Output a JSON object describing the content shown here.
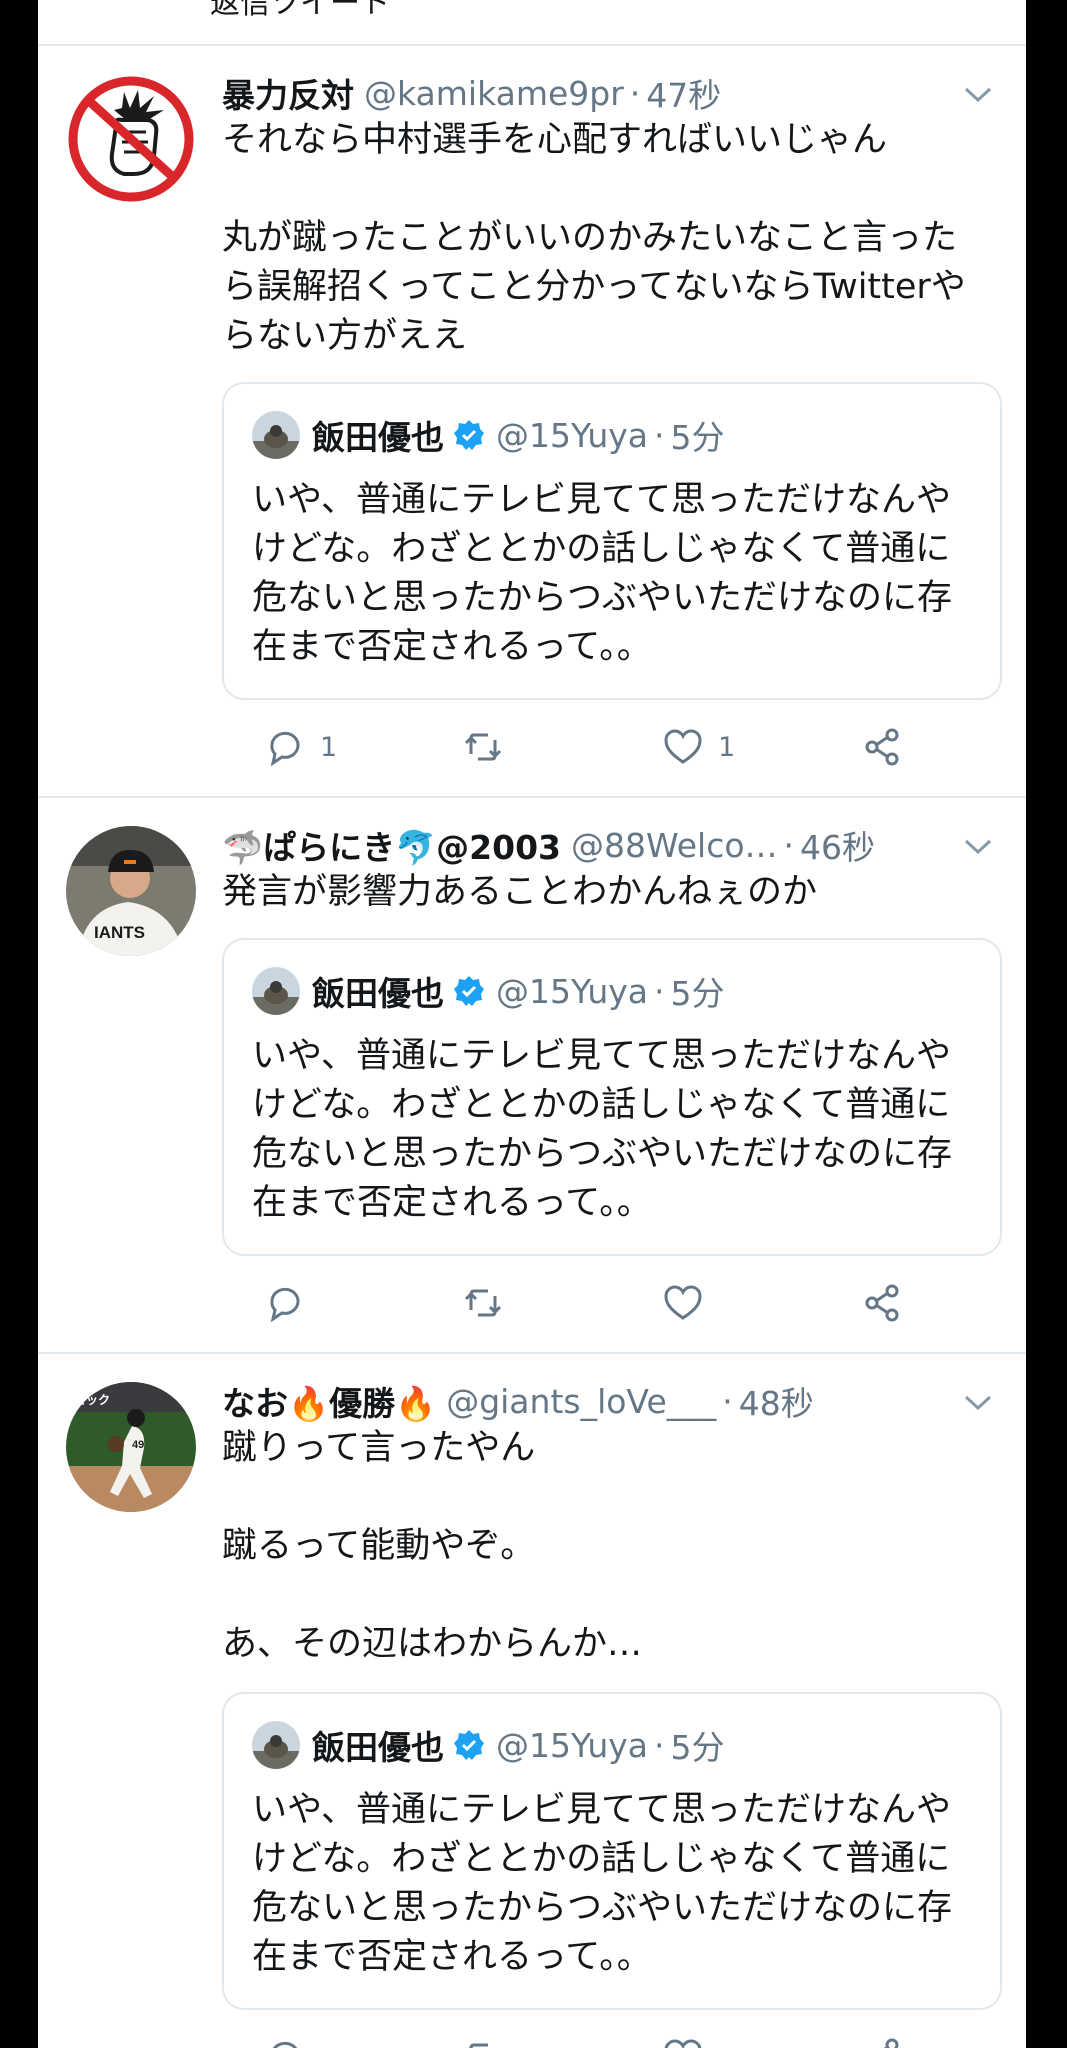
{
  "top_cut_text": "返信ツイート",
  "tweets": [
    {
      "name": "暴力反対",
      "handle": "@kamikame9pr",
      "time": "47秒",
      "text": "それなら中村選手を心配すればいいじゃん\n\n丸が蹴ったことがいいのかみたいなこと言ったら誤解招くってこと分かってないならTwitterやらない方がええ",
      "reply_count": "1",
      "retweet_count": "",
      "like_count": "1"
    },
    {
      "name": "🦈ぱらにき🐬@2003",
      "handle": "@88Welco…",
      "time": "46秒",
      "text": "発言が影響力あることわかんねぇのか",
      "reply_count": "",
      "retweet_count": "",
      "like_count": ""
    },
    {
      "name": "なお🔥優勝🔥",
      "handle": "@giants_loVe___",
      "time": "48秒",
      "text": "蹴りって言ったやん\n\n蹴るって能動やぞ。\n\nあ、その辺はわからんか…",
      "reply_count": "",
      "retweet_count": "",
      "like_count": ""
    }
  ],
  "quoted": {
    "name": "飯田優也",
    "handle": "@15Yuya",
    "time": "5分",
    "text": "いや、普通にテレビ見てて思っただけなんやけどな。わざととかの話しじゃなくて普通に危ないと思ったからつぶやいただけなのに存在まで否定されるって。。"
  },
  "sep": "·",
  "colors": {
    "verified": "#1da1f2",
    "muted": "#657786",
    "divider": "#e1e8ed"
  },
  "icons": [
    "reply-icon",
    "retweet-icon",
    "like-icon",
    "share-icon",
    "verified-badge-icon",
    "chevron-down-icon",
    "no-violence-avatar-icon"
  ]
}
